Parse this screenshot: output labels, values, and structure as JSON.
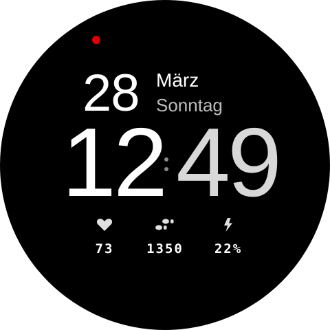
{
  "colors": {
    "background": "#000000",
    "primary_text": "#ffffff",
    "secondary_text": "#bdbdbd",
    "minutes_text": "#d8d8d8",
    "notification": "#e00000",
    "icon": "#e0e0e0"
  },
  "date": {
    "day": "28",
    "month": "März",
    "weekday": "Sonntag"
  },
  "time": {
    "hours": "12",
    "minutes": "49"
  },
  "stats": {
    "heart_rate": {
      "icon": "heart-icon",
      "value": "73"
    },
    "steps": {
      "icon": "footprints-icon",
      "value": "1350"
    },
    "battery": {
      "icon": "lightning-icon",
      "value": "22%"
    }
  }
}
